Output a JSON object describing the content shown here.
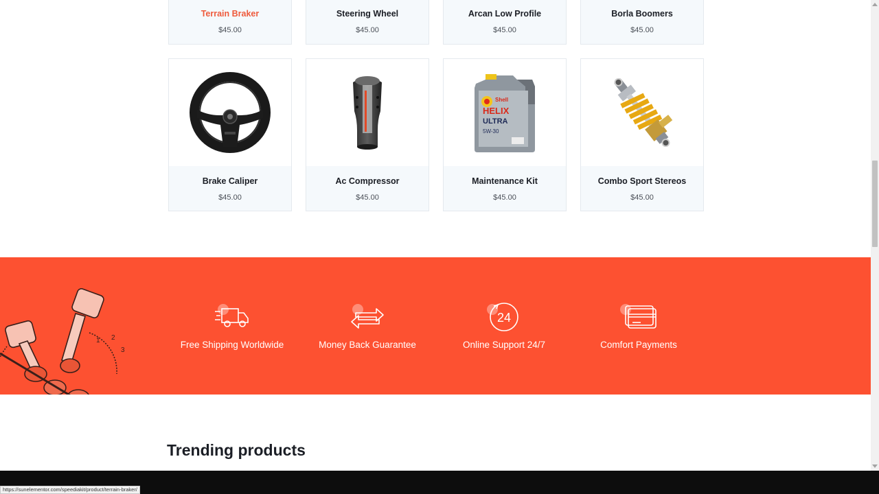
{
  "products_top": [
    {
      "name": "Terrain Braker",
      "price": "$45.00",
      "highlighted": true
    },
    {
      "name": "Steering Wheel",
      "price": "$45.00"
    },
    {
      "name": "Arcan Low Profile",
      "price": "$45.00"
    },
    {
      "name": "Borla Boomers",
      "price": "$45.00"
    }
  ],
  "products_bottom": [
    {
      "name": "Brake Caliper",
      "price": "$45.00",
      "icon": "steering-wheel-image"
    },
    {
      "name": "Ac Compressor",
      "price": "$45.00",
      "icon": "gear-shift-knob-image"
    },
    {
      "name": "Maintenance Kit",
      "price": "$45.00",
      "icon": "oil-jug-image",
      "image_text": [
        "Shell",
        "HELIX",
        "ULTRA",
        "5W-30"
      ]
    },
    {
      "name": "Combo Sport Stereos",
      "price": "$45.00",
      "icon": "shock-absorber-image"
    }
  ],
  "features": [
    {
      "label": "Free Shipping Worldwide",
      "icon": "delivery-truck-icon"
    },
    {
      "label": "Money Back Guarantee",
      "icon": "exchange-arrows-icon"
    },
    {
      "label": "Online Support 24/7",
      "icon": "support-24-icon",
      "icon_text": "24"
    },
    {
      "label": "Comfort Payments",
      "icon": "credit-card-icon"
    }
  ],
  "engine_marks": [
    "1",
    "2",
    "3"
  ],
  "section_title": "Trending products",
  "status_url": "https://sunelementor.com/speediakit/product/terrain-braker/",
  "colors": {
    "accent": "#fd5131",
    "highlight": "#ee5a3b",
    "card_bg": "#f5f9fc",
    "text_dark": "#1b1e25"
  }
}
